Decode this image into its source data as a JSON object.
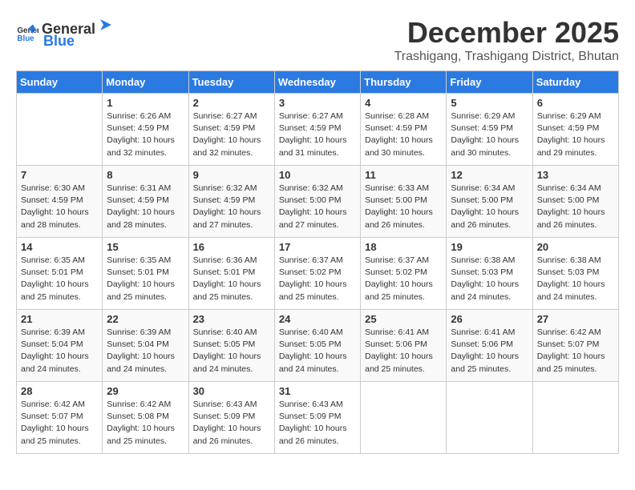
{
  "logo": {
    "text_general": "General",
    "text_blue": "Blue"
  },
  "title": "December 2025",
  "location": "Trashigang, Trashigang District, Bhutan",
  "days_of_week": [
    "Sunday",
    "Monday",
    "Tuesday",
    "Wednesday",
    "Thursday",
    "Friday",
    "Saturday"
  ],
  "weeks": [
    [
      {
        "day": "",
        "info": ""
      },
      {
        "day": "1",
        "info": "Sunrise: 6:26 AM\nSunset: 4:59 PM\nDaylight: 10 hours\nand 32 minutes."
      },
      {
        "day": "2",
        "info": "Sunrise: 6:27 AM\nSunset: 4:59 PM\nDaylight: 10 hours\nand 32 minutes."
      },
      {
        "day": "3",
        "info": "Sunrise: 6:27 AM\nSunset: 4:59 PM\nDaylight: 10 hours\nand 31 minutes."
      },
      {
        "day": "4",
        "info": "Sunrise: 6:28 AM\nSunset: 4:59 PM\nDaylight: 10 hours\nand 30 minutes."
      },
      {
        "day": "5",
        "info": "Sunrise: 6:29 AM\nSunset: 4:59 PM\nDaylight: 10 hours\nand 30 minutes."
      },
      {
        "day": "6",
        "info": "Sunrise: 6:29 AM\nSunset: 4:59 PM\nDaylight: 10 hours\nand 29 minutes."
      }
    ],
    [
      {
        "day": "7",
        "info": "Sunrise: 6:30 AM\nSunset: 4:59 PM\nDaylight: 10 hours\nand 28 minutes."
      },
      {
        "day": "8",
        "info": "Sunrise: 6:31 AM\nSunset: 4:59 PM\nDaylight: 10 hours\nand 28 minutes."
      },
      {
        "day": "9",
        "info": "Sunrise: 6:32 AM\nSunset: 4:59 PM\nDaylight: 10 hours\nand 27 minutes."
      },
      {
        "day": "10",
        "info": "Sunrise: 6:32 AM\nSunset: 5:00 PM\nDaylight: 10 hours\nand 27 minutes."
      },
      {
        "day": "11",
        "info": "Sunrise: 6:33 AM\nSunset: 5:00 PM\nDaylight: 10 hours\nand 26 minutes."
      },
      {
        "day": "12",
        "info": "Sunrise: 6:34 AM\nSunset: 5:00 PM\nDaylight: 10 hours\nand 26 minutes."
      },
      {
        "day": "13",
        "info": "Sunrise: 6:34 AM\nSunset: 5:00 PM\nDaylight: 10 hours\nand 26 minutes."
      }
    ],
    [
      {
        "day": "14",
        "info": "Sunrise: 6:35 AM\nSunset: 5:01 PM\nDaylight: 10 hours\nand 25 minutes."
      },
      {
        "day": "15",
        "info": "Sunrise: 6:35 AM\nSunset: 5:01 PM\nDaylight: 10 hours\nand 25 minutes."
      },
      {
        "day": "16",
        "info": "Sunrise: 6:36 AM\nSunset: 5:01 PM\nDaylight: 10 hours\nand 25 minutes."
      },
      {
        "day": "17",
        "info": "Sunrise: 6:37 AM\nSunset: 5:02 PM\nDaylight: 10 hours\nand 25 minutes."
      },
      {
        "day": "18",
        "info": "Sunrise: 6:37 AM\nSunset: 5:02 PM\nDaylight: 10 hours\nand 25 minutes."
      },
      {
        "day": "19",
        "info": "Sunrise: 6:38 AM\nSunset: 5:03 PM\nDaylight: 10 hours\nand 24 minutes."
      },
      {
        "day": "20",
        "info": "Sunrise: 6:38 AM\nSunset: 5:03 PM\nDaylight: 10 hours\nand 24 minutes."
      }
    ],
    [
      {
        "day": "21",
        "info": "Sunrise: 6:39 AM\nSunset: 5:04 PM\nDaylight: 10 hours\nand 24 minutes."
      },
      {
        "day": "22",
        "info": "Sunrise: 6:39 AM\nSunset: 5:04 PM\nDaylight: 10 hours\nand 24 minutes."
      },
      {
        "day": "23",
        "info": "Sunrise: 6:40 AM\nSunset: 5:05 PM\nDaylight: 10 hours\nand 24 minutes."
      },
      {
        "day": "24",
        "info": "Sunrise: 6:40 AM\nSunset: 5:05 PM\nDaylight: 10 hours\nand 24 minutes."
      },
      {
        "day": "25",
        "info": "Sunrise: 6:41 AM\nSunset: 5:06 PM\nDaylight: 10 hours\nand 25 minutes."
      },
      {
        "day": "26",
        "info": "Sunrise: 6:41 AM\nSunset: 5:06 PM\nDaylight: 10 hours\nand 25 minutes."
      },
      {
        "day": "27",
        "info": "Sunrise: 6:42 AM\nSunset: 5:07 PM\nDaylight: 10 hours\nand 25 minutes."
      }
    ],
    [
      {
        "day": "28",
        "info": "Sunrise: 6:42 AM\nSunset: 5:07 PM\nDaylight: 10 hours\nand 25 minutes."
      },
      {
        "day": "29",
        "info": "Sunrise: 6:42 AM\nSunset: 5:08 PM\nDaylight: 10 hours\nand 25 minutes."
      },
      {
        "day": "30",
        "info": "Sunrise: 6:43 AM\nSunset: 5:09 PM\nDaylight: 10 hours\nand 26 minutes."
      },
      {
        "day": "31",
        "info": "Sunrise: 6:43 AM\nSunset: 5:09 PM\nDaylight: 10 hours\nand 26 minutes."
      },
      {
        "day": "",
        "info": ""
      },
      {
        "day": "",
        "info": ""
      },
      {
        "day": "",
        "info": ""
      }
    ]
  ]
}
